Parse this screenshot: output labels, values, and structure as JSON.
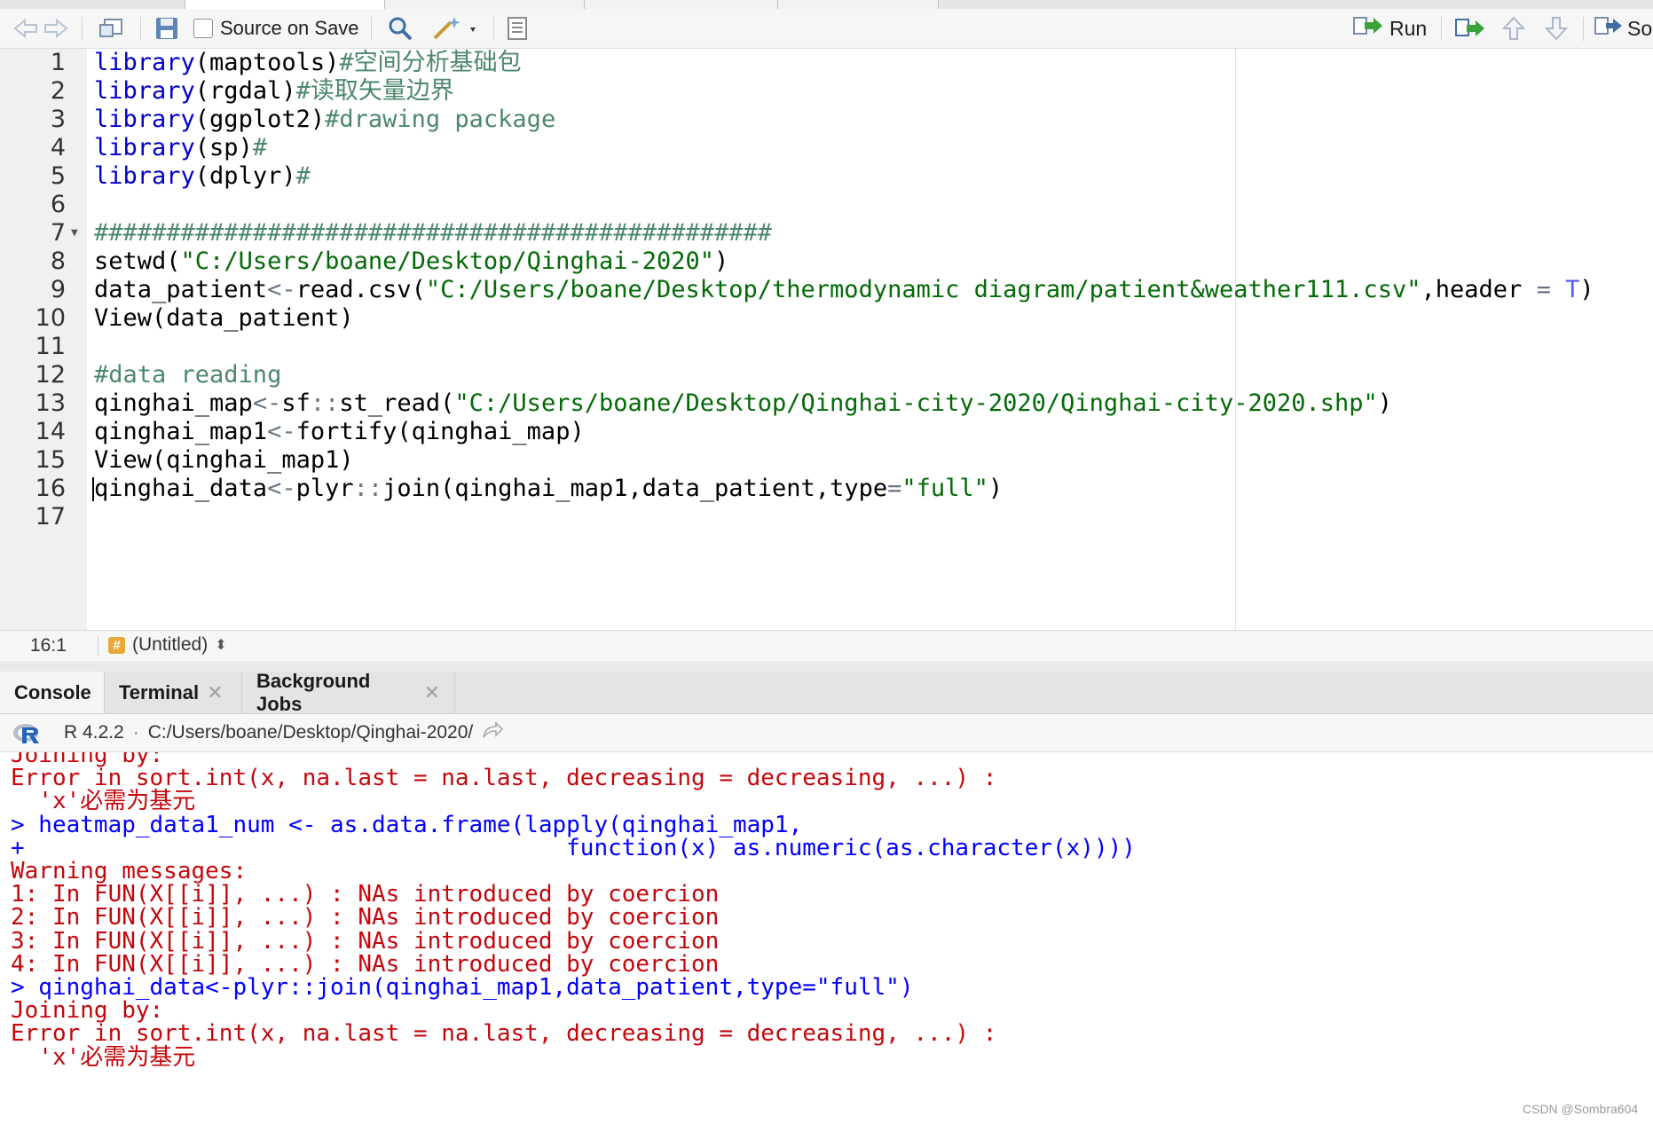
{
  "toolbar": {
    "source_on_save_label": "Source on Save",
    "run_label": "Run",
    "source_label_partial": "So"
  },
  "editor": {
    "lines": [
      {
        "number": "1",
        "tokens": [
          {
            "t": "library",
            "c": "kw"
          },
          {
            "t": "(maptools)",
            "c": "punc"
          },
          {
            "t": "#空间分析基础包",
            "c": "com"
          }
        ]
      },
      {
        "number": "2",
        "tokens": [
          {
            "t": "library",
            "c": "kw"
          },
          {
            "t": "(rgdal)",
            "c": "punc"
          },
          {
            "t": "#读取矢量边界",
            "c": "com"
          }
        ]
      },
      {
        "number": "3",
        "tokens": [
          {
            "t": "library",
            "c": "kw"
          },
          {
            "t": "(ggplot2)",
            "c": "punc"
          },
          {
            "t": "#drawing package",
            "c": "com"
          }
        ]
      },
      {
        "number": "4",
        "tokens": [
          {
            "t": "library",
            "c": "kw"
          },
          {
            "t": "(sp)",
            "c": "punc"
          },
          {
            "t": "#",
            "c": "com"
          }
        ]
      },
      {
        "number": "5",
        "tokens": [
          {
            "t": "library",
            "c": "kw"
          },
          {
            "t": "(dplyr)",
            "c": "punc"
          },
          {
            "t": "#",
            "c": "com"
          }
        ]
      },
      {
        "number": "6",
        "tokens": []
      },
      {
        "number": "7",
        "fold": true,
        "tokens": [
          {
            "t": "###############################################",
            "c": "com"
          }
        ]
      },
      {
        "number": "8",
        "tokens": [
          {
            "t": "setwd(",
            "c": "punc"
          },
          {
            "t": "\"C:/Users/boane/Desktop/Qinghai-2020\"",
            "c": "str"
          },
          {
            "t": ")",
            "c": "punc"
          }
        ]
      },
      {
        "number": "9",
        "tokens": [
          {
            "t": "data_patient",
            "c": "punc"
          },
          {
            "t": "<-",
            "c": "op"
          },
          {
            "t": "read.csv(",
            "c": "punc"
          },
          {
            "t": "\"C:/Users/boane/Desktop/thermodynamic diagram/patient&weather111.csv\"",
            "c": "str"
          },
          {
            "t": ",header ",
            "c": "punc"
          },
          {
            "t": "=",
            "c": "op"
          },
          {
            "t": " ",
            "c": "punc"
          },
          {
            "t": "T",
            "c": "const"
          },
          {
            "t": ")",
            "c": "punc"
          }
        ]
      },
      {
        "number": "10",
        "tokens": [
          {
            "t": "View(data_patient)",
            "c": "punc"
          }
        ]
      },
      {
        "number": "11",
        "tokens": []
      },
      {
        "number": "12",
        "tokens": [
          {
            "t": "#data reading",
            "c": "com"
          }
        ]
      },
      {
        "number": "13",
        "tokens": [
          {
            "t": "qinghai_map",
            "c": "punc"
          },
          {
            "t": "<-",
            "c": "op"
          },
          {
            "t": "sf",
            "c": "punc"
          },
          {
            "t": "::",
            "c": "op"
          },
          {
            "t": "st_read(",
            "c": "punc"
          },
          {
            "t": "\"C:/Users/boane/Desktop/Qinghai-city-2020/Qinghai-city-2020.shp\"",
            "c": "str"
          },
          {
            "t": ")",
            "c": "punc"
          }
        ]
      },
      {
        "number": "14",
        "tokens": [
          {
            "t": "qinghai_map1",
            "c": "punc"
          },
          {
            "t": "<-",
            "c": "op"
          },
          {
            "t": "fortify(qinghai_map)",
            "c": "punc"
          }
        ]
      },
      {
        "number": "15",
        "tokens": [
          {
            "t": "View(qinghai_map1)",
            "c": "punc"
          }
        ]
      },
      {
        "number": "16",
        "cursor": true,
        "tokens": [
          {
            "t": "qinghai_data",
            "c": "punc"
          },
          {
            "t": "<-",
            "c": "op"
          },
          {
            "t": "plyr",
            "c": "punc"
          },
          {
            "t": "::",
            "c": "op"
          },
          {
            "t": "join(qinghai_map1,data_patient,type",
            "c": "punc"
          },
          {
            "t": "=",
            "c": "op"
          },
          {
            "t": "\"full\"",
            "c": "str"
          },
          {
            "t": ")",
            "c": "punc"
          }
        ]
      },
      {
        "number": "17",
        "tokens": []
      }
    ]
  },
  "status_bar": {
    "cursor_position": "16:1",
    "file_type_icon": "#",
    "file_name": "(Untitled)",
    "menu_arrows": "⬍"
  },
  "console_tabs": [
    {
      "label": "Console",
      "active": true,
      "closable": false
    },
    {
      "label": "Terminal",
      "active": false,
      "closable": true
    },
    {
      "label": "Background Jobs",
      "active": false,
      "closable": true
    }
  ],
  "console_header": {
    "r_version": "R 4.2.2",
    "separator": "·",
    "working_dir": "C:/Users/boane/Desktop/Qinghai-2020/"
  },
  "console": {
    "lines": [
      {
        "text": "Joining by:",
        "kind": "err"
      },
      {
        "text": "Error in sort.int(x, na.last = na.last, decreasing = decreasing, ...) :",
        "kind": "err"
      },
      {
        "text": "  'x'必需为基元",
        "kind": "err"
      },
      {
        "text": "> heatmap_data1_num <- as.data.frame(lapply(qinghai_map1,",
        "kind": "in"
      },
      {
        "text": "+                                       function(x) as.numeric(as.character(x))))",
        "kind": "in"
      },
      {
        "text": "Warning messages:",
        "kind": "err"
      },
      {
        "text": "1: In FUN(X[[i]], ...) : NAs introduced by coercion",
        "kind": "err"
      },
      {
        "text": "2: In FUN(X[[i]], ...) : NAs introduced by coercion",
        "kind": "err"
      },
      {
        "text": "3: In FUN(X[[i]], ...) : NAs introduced by coercion",
        "kind": "err"
      },
      {
        "text": "4: In FUN(X[[i]], ...) : NAs introduced by coercion",
        "kind": "err"
      },
      {
        "text": "> qinghai_data<-plyr::join(qinghai_map1,data_patient,type=\"full\")",
        "kind": "in"
      },
      {
        "text": "Joining by:",
        "kind": "err"
      },
      {
        "text": "Error in sort.int(x, na.last = na.last, decreasing = decreasing, ...) :",
        "kind": "err"
      },
      {
        "text": "  'x'必需为基元",
        "kind": "err"
      }
    ]
  },
  "watermark": "CSDN @Sombra604",
  "colors": {
    "keyword": "#0000cc",
    "string": "#036a07",
    "comment": "#4c886b",
    "console_error": "#c5060b",
    "console_input": "#0000ff",
    "run_arrow": "#3aa33a"
  },
  "icons": [
    "back-arrow-icon",
    "forward-arrow-icon",
    "show-in-window-icon",
    "save-icon",
    "search-icon",
    "code-tools-wand-icon",
    "document-outline-icon",
    "run-icon",
    "rerun-icon",
    "go-up-icon",
    "go-down-icon",
    "source-icon",
    "r-logo-icon",
    "follow-link-icon"
  ]
}
